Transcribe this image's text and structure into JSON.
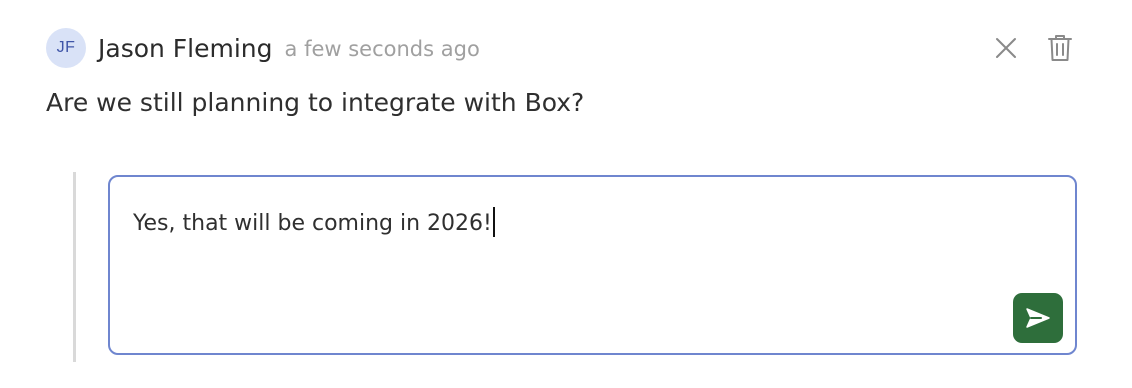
{
  "comment": {
    "avatar_initials": "JF",
    "author": "Jason Fleming",
    "timestamp": "a few seconds ago",
    "text": "Are we still planning to integrate with Box?"
  },
  "actions": {
    "close_icon": "close-icon",
    "delete_icon": "trash-icon"
  },
  "reply": {
    "value": "Yes, that will be coming in 2026!",
    "send_icon": "send-icon"
  },
  "colors": {
    "avatar_bg": "#d9e2f7",
    "avatar_text": "#3f55a8",
    "reply_border": "#6f86cf",
    "send_button": "#2e6e3b",
    "timestamp": "#a0a0a0",
    "thread_line": "#d9d9d9"
  }
}
